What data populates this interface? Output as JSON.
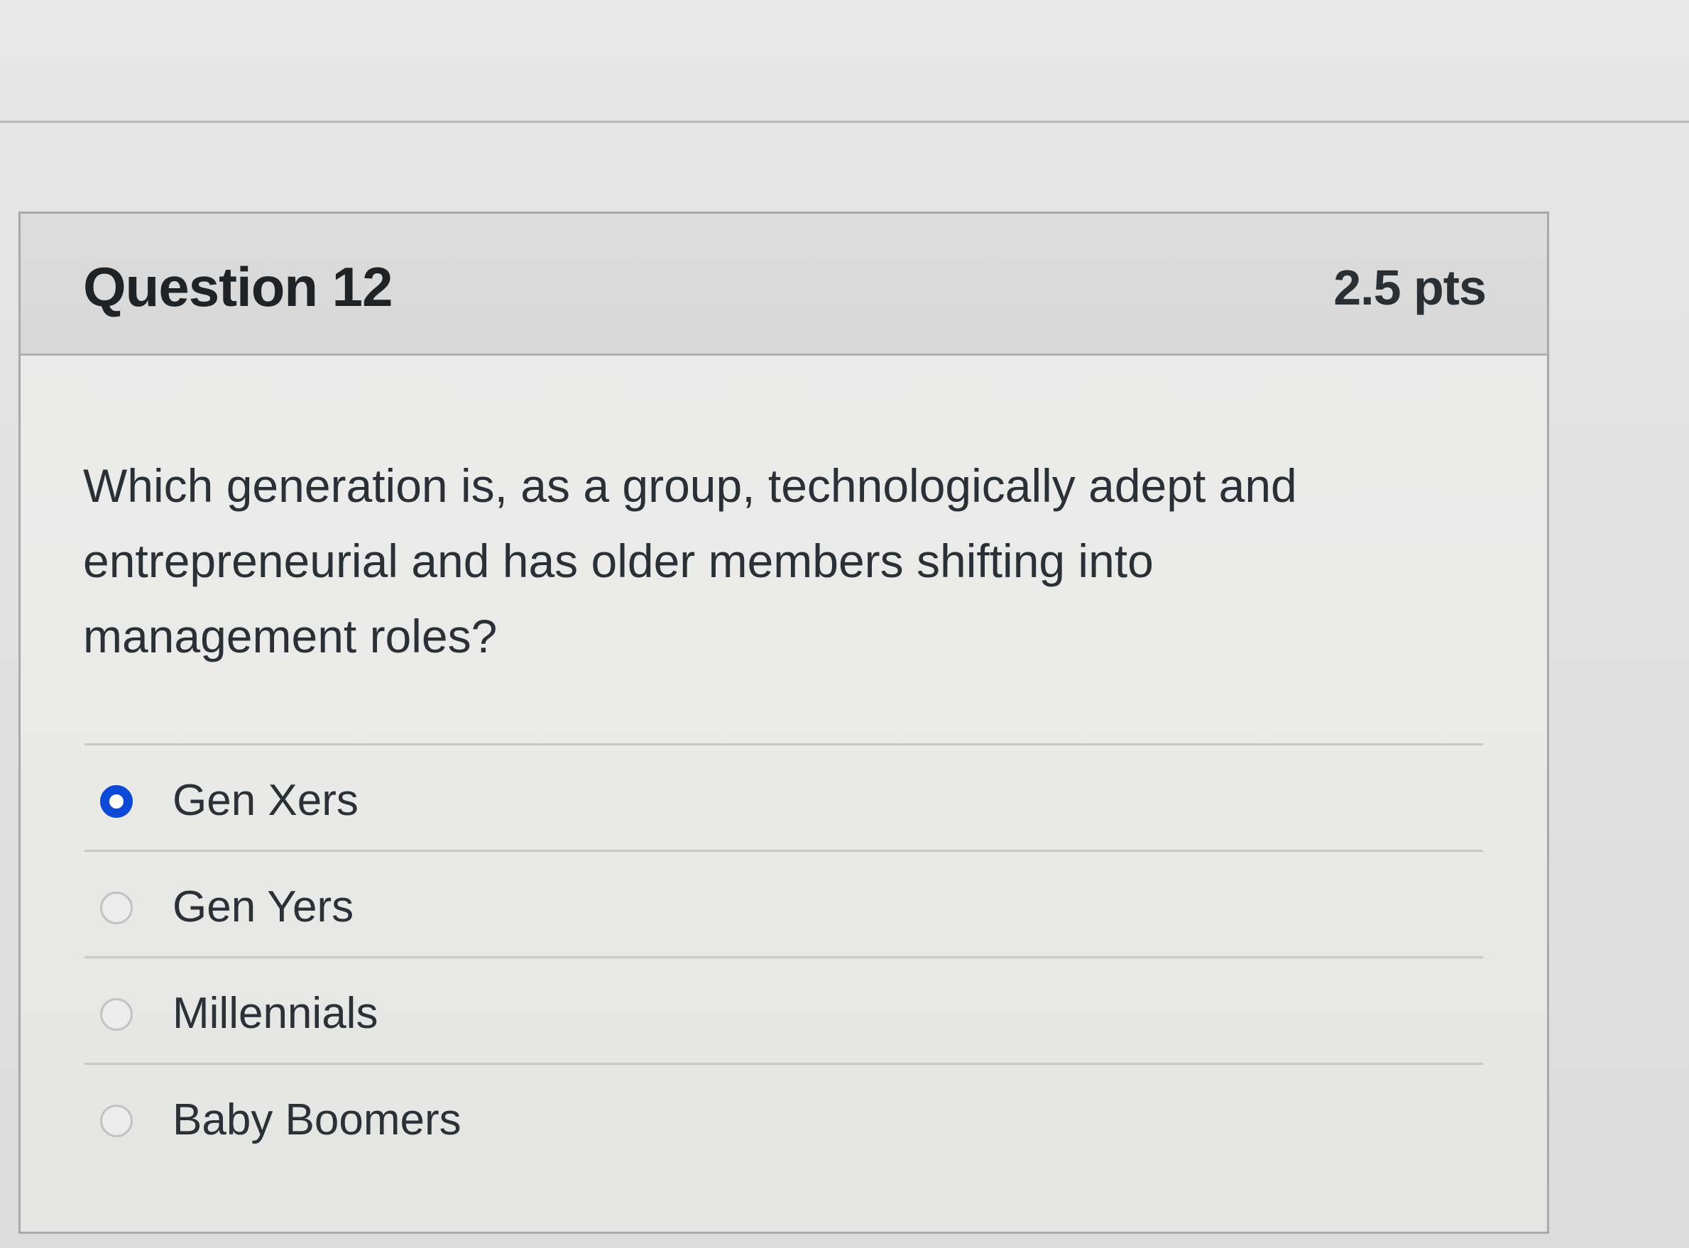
{
  "question": {
    "title": "Question 12",
    "points": "2.5 pts",
    "text": "Which generation is, as a group, technologically adept and entrepreneurial and has older members shifting into management roles?"
  },
  "answers": [
    {
      "label": "Gen Xers",
      "selected": true
    },
    {
      "label": "Gen Yers",
      "selected": false
    },
    {
      "label": "Millennials",
      "selected": false
    },
    {
      "label": "Baby Boomers",
      "selected": false
    }
  ],
  "colors": {
    "selected_radio": "#0b49d6"
  }
}
